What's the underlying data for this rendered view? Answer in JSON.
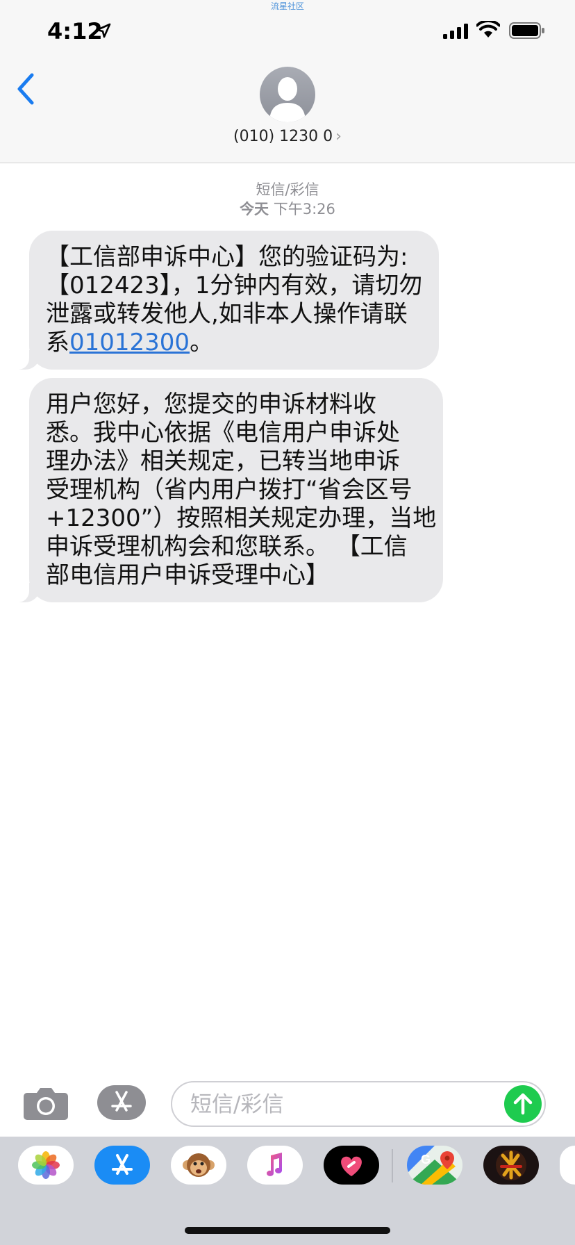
{
  "watermark": "流星社区",
  "status_bar": {
    "time": "4:12"
  },
  "header": {
    "contact": "(010) 1230 0",
    "chevron": "›"
  },
  "thread": {
    "service_label": "短信/彩信",
    "timestamp_day": "今天",
    "timestamp_time": "下午3:26"
  },
  "messages": [
    {
      "lines": [
        "【工信部申诉中心】您的验证码为:",
        "【012423】，1分钟内有效，请切勿",
        "泄露或转发他人,如非本人操作请联"
      ],
      "last_prefix": "系",
      "link": "01012300",
      "last_suffix": "。"
    },
    {
      "lines": [
        "用户您好，您提交的申诉材料收",
        "悉。我中心依据《电信用户申诉处",
        "理办法》相关规定，已转当地申诉",
        "受理机构（省内用户拨打“省会区号",
        "+12300”）按照相关规定办理，当地",
        "申诉受理机构会和您联系。 【工信",
        "部电信用户申诉受理中心】"
      ]
    }
  ],
  "input": {
    "placeholder": "短信/彩信"
  },
  "apps": [
    {
      "name": "photos-app-icon"
    },
    {
      "name": "app-store-app-icon"
    },
    {
      "name": "memoji-app-icon"
    },
    {
      "name": "music-app-icon"
    },
    {
      "name": "digital-touch-app-icon"
    },
    {
      "name": "google-maps-app-icon"
    },
    {
      "name": "game-app-icon"
    }
  ],
  "colors": {
    "accent_blue": "#2a73d6",
    "send_green": "#1ecb4f",
    "bubble_gray": "#e9e9eb"
  }
}
